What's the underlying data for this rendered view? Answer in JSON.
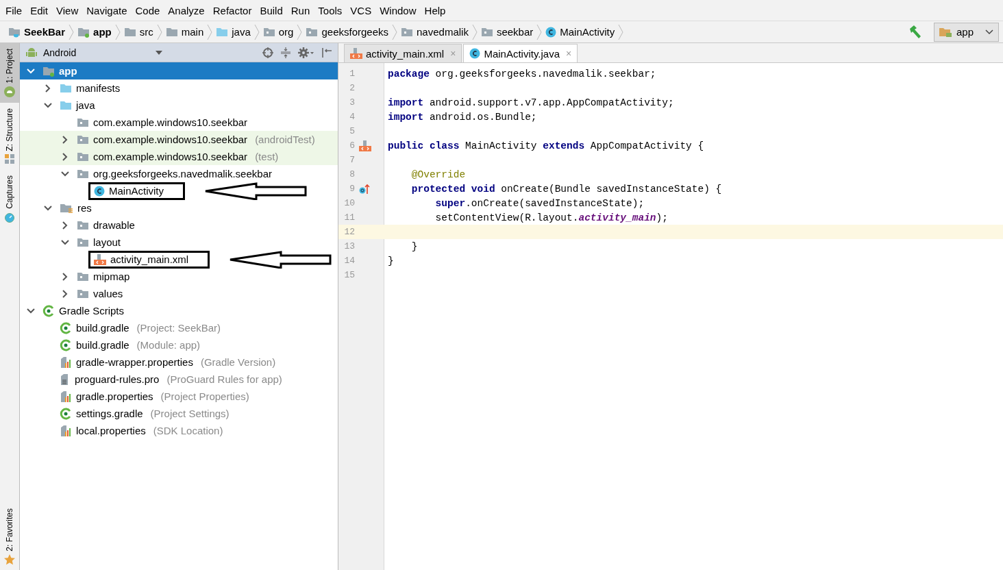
{
  "menu": [
    "File",
    "Edit",
    "View",
    "Navigate",
    "Code",
    "Analyze",
    "Refactor",
    "Build",
    "Run",
    "Tools",
    "VCS",
    "Window",
    "Help"
  ],
  "breadcrumbs": [
    {
      "label": "SeekBar",
      "kind": "project",
      "bold": true
    },
    {
      "label": "app",
      "kind": "module",
      "bold": true
    },
    {
      "label": "src",
      "kind": "folder",
      "bold": false
    },
    {
      "label": "main",
      "kind": "folder",
      "bold": false
    },
    {
      "label": "java",
      "kind": "source",
      "bold": false
    },
    {
      "label": "org",
      "kind": "package",
      "bold": false
    },
    {
      "label": "geeksforgeeks",
      "kind": "package",
      "bold": false
    },
    {
      "label": "navedmalik",
      "kind": "package",
      "bold": false
    },
    {
      "label": "seekbar",
      "kind": "package",
      "bold": false
    },
    {
      "label": "MainActivity",
      "kind": "class",
      "bold": false
    }
  ],
  "run_config": {
    "label": "app"
  },
  "side_tools_top": [
    {
      "label": "1: Project",
      "kind": "android",
      "selected": true
    },
    {
      "label": "Z: Structure",
      "kind": "structure",
      "selected": false
    },
    {
      "label": "Captures",
      "kind": "captures",
      "selected": false
    }
  ],
  "side_tools_bottom": [
    {
      "label": "2: Favorites",
      "kind": "star",
      "selected": false
    }
  ],
  "project_panel": {
    "view": "Android",
    "tree": [
      {
        "label": "app",
        "kind": "module",
        "bold": true,
        "selected": true,
        "expanded": true,
        "children": [
          {
            "label": "manifests",
            "kind": "source",
            "selected": false,
            "expanded": false
          },
          {
            "label": "java",
            "kind": "source",
            "selected": false,
            "expanded": true,
            "children": [
              {
                "label": "com.example.windows10.seekbar",
                "kind": "package",
                "selected": false
              },
              {
                "label": "com.example.windows10.seekbar",
                "note": "(androidTest)",
                "kind": "package",
                "selected": false,
                "expanded": false,
                "test": true
              },
              {
                "label": "com.example.windows10.seekbar",
                "note": "(test)",
                "kind": "package",
                "selected": false,
                "expanded": false,
                "test": true
              },
              {
                "label": "org.geeksforgeeks.navedmalik.seekbar",
                "kind": "package",
                "selected": false,
                "expanded": true,
                "children": [
                  {
                    "label": "MainActivity",
                    "kind": "class",
                    "selected": false,
                    "annotated": true
                  }
                ]
              }
            ]
          },
          {
            "label": "res",
            "kind": "res",
            "selected": false,
            "expanded": true,
            "children": [
              {
                "label": "drawable",
                "kind": "package",
                "selected": false,
                "expanded": false
              },
              {
                "label": "layout",
                "kind": "package",
                "selected": false,
                "expanded": true,
                "children": [
                  {
                    "label": "activity_main.xml",
                    "kind": "xml",
                    "selected": false,
                    "annotated": true
                  }
                ]
              },
              {
                "label": "mipmap",
                "kind": "package",
                "selected": false,
                "expanded": false
              },
              {
                "label": "values",
                "kind": "package",
                "selected": false,
                "expanded": false
              }
            ]
          }
        ]
      },
      {
        "label": "Gradle Scripts",
        "kind": "gradle",
        "selected": false,
        "expanded": true,
        "children": [
          {
            "label": "build.gradle",
            "note": "(Project: SeekBar)",
            "kind": "gradle",
            "selected": false
          },
          {
            "label": "build.gradle",
            "note": "(Module: app)",
            "kind": "gradle",
            "selected": false
          },
          {
            "label": "gradle-wrapper.properties",
            "note": "(Gradle Version)",
            "kind": "properties",
            "selected": false
          },
          {
            "label": "proguard-rules.pro",
            "note": "(ProGuard Rules for app)",
            "kind": "text",
            "selected": false
          },
          {
            "label": "gradle.properties",
            "note": "(Project Properties)",
            "kind": "properties",
            "selected": false
          },
          {
            "label": "settings.gradle",
            "note": "(Project Settings)",
            "kind": "gradle",
            "selected": false
          },
          {
            "label": "local.properties",
            "note": "(SDK Location)",
            "kind": "properties",
            "selected": false
          }
        ]
      }
    ]
  },
  "editor_tabs": [
    {
      "label": "activity_main.xml",
      "kind": "xml",
      "selected": false,
      "close": "×"
    },
    {
      "label": "MainActivity.java",
      "kind": "class",
      "selected": true,
      "close": "×"
    }
  ],
  "code_lines": [
    {
      "number": "1",
      "kind": "plain",
      "current": false,
      "tokens": [
        {
          "text": "package",
          "kind": "keyword"
        },
        {
          "text": " org.geeksforgeeks.navedmalik.seekbar;",
          "kind": "plain"
        }
      ]
    },
    {
      "number": "2",
      "kind": "plain",
      "current": false
    },
    {
      "number": "3",
      "kind": "plain",
      "current": false,
      "tokens": [
        {
          "text": "import",
          "kind": "keyword"
        },
        {
          "text": " android.support.v7.app.AppCompatActivity;",
          "kind": "plain"
        }
      ]
    },
    {
      "number": "4",
      "kind": "plain",
      "current": false,
      "tokens": [
        {
          "text": "import",
          "kind": "keyword"
        },
        {
          "text": " android.os.Bundle;",
          "kind": "plain"
        }
      ]
    },
    {
      "number": "5",
      "kind": "plain",
      "current": false
    },
    {
      "number": "6",
      "kind": "layout-link",
      "current": false,
      "tokens": [
        {
          "text": "public class",
          "kind": "keyword"
        },
        {
          "text": " MainActivity ",
          "kind": "plain"
        },
        {
          "text": "extends",
          "kind": "keyword"
        },
        {
          "text": " AppCompatActivity {",
          "kind": "plain"
        }
      ]
    },
    {
      "number": "7",
      "kind": "plain",
      "current": false
    },
    {
      "number": "8",
      "kind": "plain",
      "current": false,
      "tokens": [
        {
          "text": "    @Override",
          "kind": "annotation"
        }
      ]
    },
    {
      "number": "9",
      "kind": "override",
      "current": false,
      "tokens": [
        {
          "text": "    protected void",
          "kind": "keyword"
        },
        {
          "text": " onCreate(Bundle savedInstanceState) {",
          "kind": "plain"
        }
      ]
    },
    {
      "number": "10",
      "kind": "plain",
      "current": false,
      "tokens": [
        {
          "text": "        super",
          "kind": "keyword"
        },
        {
          "text": ".onCreate(savedInstanceState);",
          "kind": "plain"
        }
      ]
    },
    {
      "number": "11",
      "kind": "plain",
      "current": false,
      "tokens": [
        {
          "text": "        setContentView(R.layout.",
          "kind": "plain"
        },
        {
          "text": "activity_main",
          "kind": "field"
        },
        {
          "text": ");",
          "kind": "plain"
        }
      ]
    },
    {
      "number": "12",
      "kind": "plain",
      "current": true
    },
    {
      "number": "13",
      "kind": "plain",
      "current": false,
      "tokens": [
        {
          "text": "    }",
          "kind": "plain"
        }
      ]
    },
    {
      "number": "14",
      "kind": "plain",
      "current": false,
      "tokens": [
        {
          "text": "}",
          "kind": "plain"
        }
      ]
    },
    {
      "number": "15",
      "kind": "plain",
      "current": false
    }
  ]
}
